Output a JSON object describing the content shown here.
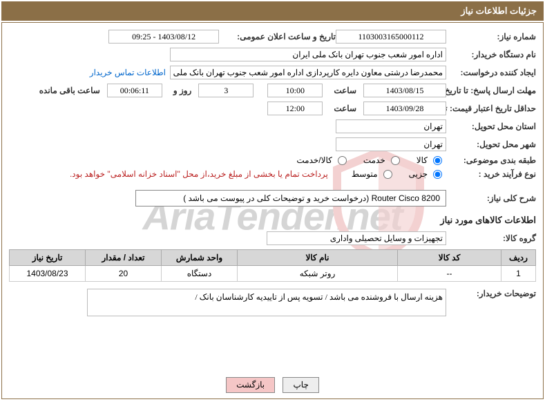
{
  "header": {
    "title": "جزئیات اطلاعات نیاز"
  },
  "fields": {
    "need_number_label": "شماره نیاز:",
    "need_number": "1103003165000112",
    "announce_datetime_label": "تاریخ و ساعت اعلان عمومی:",
    "announce_datetime": "1403/08/12 - 09:25",
    "buyer_org_label": "نام دستگاه خریدار:",
    "buyer_org": "اداره امور شعب جنوب تهران بانک ملی ایران",
    "requester_label": "ایجاد کننده درخواست:",
    "requester": "محمدرضا درشتی معاون دایره کارپردازی اداره امور شعب جنوب تهران بانک ملی ا",
    "contact_link": "اطلاعات تماس خریدار",
    "response_deadline_label": "مهلت ارسال پاسخ: تا تاریخ:",
    "response_date": "1403/08/15",
    "time_label": "ساعت",
    "response_time": "10:00",
    "days_value": "3",
    "days_and_label": "روز و",
    "countdown": "00:06:11",
    "remaining_label": "ساعت باقی مانده",
    "validity_label": "حداقل تاریخ اعتبار قیمت: تا تاریخ:",
    "validity_date": "1403/09/28",
    "validity_time": "12:00",
    "province_label": "استان محل تحویل:",
    "province": "تهران",
    "city_label": "شهر محل تحویل:",
    "city": "تهران",
    "category_label": "طبقه بندی موضوعی:",
    "cat_goods": "کالا",
    "cat_service": "خدمت",
    "cat_goods_service": "کالا/خدمت",
    "purchase_type_label": "نوع فرآیند خرید :",
    "pt_partial": "جزیی",
    "pt_medium": "متوسط",
    "pt_note": "پرداخت تمام یا بخشی از مبلغ خرید،از محل \"اسناد خزانه اسلامی\" خواهد بود.",
    "overview_label": "شرح کلی نیاز:",
    "overview": "Router  Cisco  8200 (درخواست خرید و توضیحات کلی در پیوست می باشد )",
    "goods_section": "اطلاعات کالاهای مورد نیاز",
    "goods_group_label": "گروه کالا:",
    "goods_group": "تجهیزات و وسایل تحصیلی واداری",
    "buyer_notes_label": "توضیحات خریدار:",
    "buyer_notes": "هزینه ارسال با فروشنده می باشد / تسویه پس از تاییدیه کارشناسان بانک /"
  },
  "table": {
    "headers": {
      "row": "ردیف",
      "code": "کد کالا",
      "name": "نام کالا",
      "unit": "واحد شمارش",
      "qty": "تعداد / مقدار",
      "date": "تاریخ نیاز"
    },
    "rows": [
      {
        "row": "1",
        "code": "--",
        "name": "روتر شبکه",
        "unit": "دستگاه",
        "qty": "20",
        "date": "1403/08/23"
      }
    ]
  },
  "buttons": {
    "print": "چاپ",
    "back": "بازگشت"
  },
  "watermark": {
    "text": "AriaTender.net"
  }
}
